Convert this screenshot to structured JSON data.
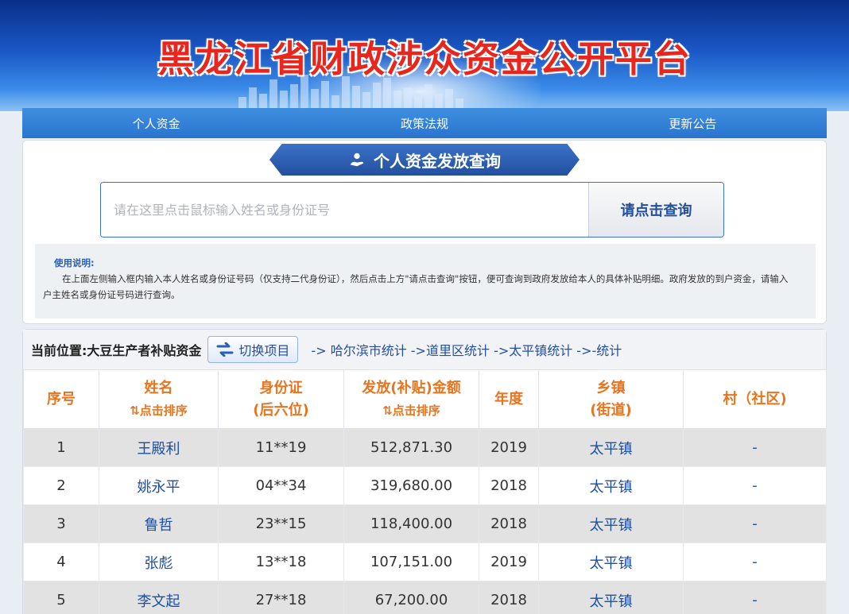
{
  "header": {
    "title": "黑龙江省财政涉众资金公开平台"
  },
  "nav": {
    "items": [
      "个人资金",
      "政策法规",
      "更新公告"
    ]
  },
  "query": {
    "ribbon_title": "个人资金发放查询",
    "placeholder": "请在这里点击鼠标输入姓名或身份证号",
    "button_label": "请点击查询",
    "instructions_title": "使用说明:",
    "instructions_body": "在上面左侧输入框内输入本人姓名或身份证号码（仅支持二代身份证），然后点击上方\"请点击查询\"按钮，便可查询到政府发放给本人的具体补贴明细。政府发放的到户资金，请输入户主姓名或身份证号码进行查询。"
  },
  "results": {
    "location_label": "当前位置:大豆生产者补贴资金",
    "switch_label": "切换项目",
    "crumbs": "-> 哈尔滨市统计 ->道里区统计 ->太平镇统计 ->-统计",
    "headers": {
      "index": "序号",
      "name": "姓名",
      "name_sort": "⇅点击排序",
      "id_line1": "身份证",
      "id_line2": "(后六位)",
      "amount": "发放(补贴)金额",
      "amount_sort": "⇅点击排序",
      "year": "年度",
      "town_line1": "乡镇",
      "town_line2": "(街道)",
      "village": "村（社区)"
    },
    "rows": [
      {
        "index": "1",
        "name": "王殿利",
        "id": "11**19",
        "amount": "512,871.30",
        "year": "2019",
        "town": "太平镇",
        "village": "-"
      },
      {
        "index": "2",
        "name": "姚永平",
        "id": "04**34",
        "amount": "319,680.00",
        "year": "2018",
        "town": "太平镇",
        "village": "-"
      },
      {
        "index": "3",
        "name": "鲁哲",
        "id": "23**15",
        "amount": "118,400.00",
        "year": "2018",
        "town": "太平镇",
        "village": "-"
      },
      {
        "index": "4",
        "name": "张彪",
        "id": "13**18",
        "amount": "107,151.00",
        "year": "2019",
        "town": "太平镇",
        "village": "-"
      },
      {
        "index": "5",
        "name": "李文起",
        "id": "27**18",
        "amount": "67,200.00",
        "year": "2018",
        "town": "太平镇",
        "village": "-"
      }
    ]
  },
  "colors": {
    "title_red": "#e8261e",
    "header_orange": "#e8741e",
    "link_blue": "#1a4fa8",
    "nav_blue": "#2a74cf"
  }
}
